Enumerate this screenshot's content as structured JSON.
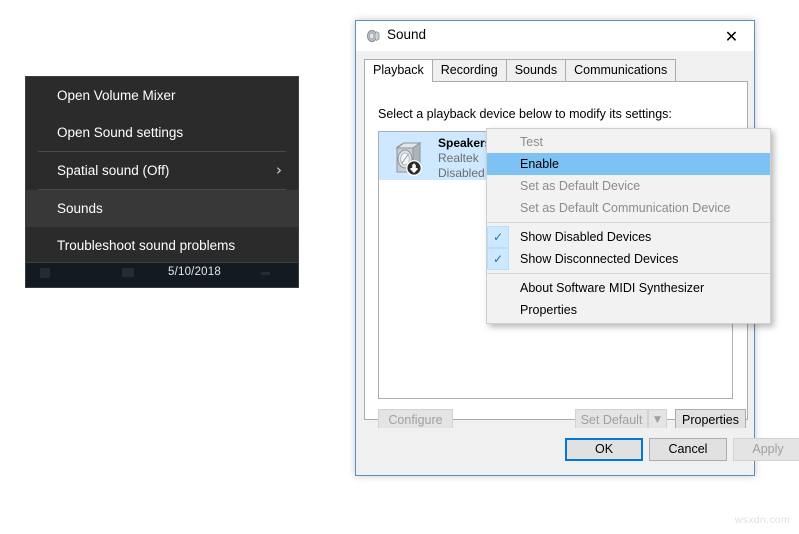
{
  "volume_flyout": {
    "items": [
      {
        "label": "Open Volume Mixer",
        "selected": false,
        "submenu": false
      },
      {
        "label": "Open Sound settings",
        "selected": false,
        "submenu": false
      },
      {
        "label": "Spatial sound (Off)",
        "selected": false,
        "submenu": true,
        "chevron": "›"
      },
      {
        "label": "Sounds",
        "selected": true,
        "submenu": false
      },
      {
        "label": "Troubleshoot sound problems",
        "selected": false,
        "submenu": false
      }
    ],
    "taskbar_clock": "5/10/2018"
  },
  "sound_dialog": {
    "title": "Sound",
    "close_glyph": "✕",
    "tabs": [
      {
        "label": "Playback",
        "active": true
      },
      {
        "label": "Recording",
        "active": false
      },
      {
        "label": "Sounds",
        "active": false
      },
      {
        "label": "Communications",
        "active": false
      }
    ],
    "instruction": "Select a playback device below to modify its settings:",
    "devices": [
      {
        "name": "Speakers",
        "driver": "Realtek",
        "status": "Disabled",
        "selected": true
      }
    ],
    "panel_buttons": {
      "configure": "Configure",
      "set_default": "Set Default",
      "set_default_arrow": "▼",
      "properties": "Properties"
    },
    "footer_buttons": {
      "ok": "OK",
      "cancel": "Cancel",
      "apply": "Apply"
    }
  },
  "context_menu": {
    "check_glyph": "✓",
    "items": [
      {
        "label": "Test",
        "state": "disabled",
        "checked": false
      },
      {
        "label": "Enable",
        "state": "highlight",
        "checked": false
      },
      {
        "label": "Set as Default Device",
        "state": "disabled",
        "checked": false
      },
      {
        "label": "Set as Default Communication Device",
        "state": "disabled",
        "checked": false
      },
      {
        "separator": true
      },
      {
        "label": "Show Disabled Devices",
        "state": "normal",
        "checked": true
      },
      {
        "label": "Show Disconnected Devices",
        "state": "normal",
        "checked": true
      },
      {
        "separator": true
      },
      {
        "label": "About Software MIDI Synthesizer",
        "state": "normal",
        "checked": false
      },
      {
        "label": "Properties",
        "state": "normal",
        "checked": false
      }
    ]
  },
  "watermark": "wsxdn.com",
  "colors": {
    "accent": "#0078d7",
    "menu_highlight": "#7ec2f3",
    "selection": "#cde8ff",
    "flyout_bg": "#2b2b2b"
  }
}
